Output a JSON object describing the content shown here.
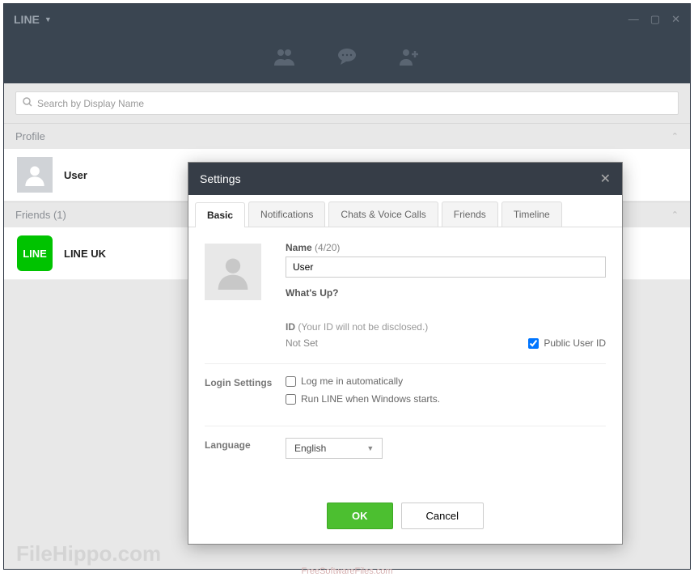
{
  "titlebar": {
    "app": "LINE"
  },
  "search": {
    "placeholder": "Search by Display Name"
  },
  "sections": {
    "profile": {
      "label": "Profile",
      "user_name": "User"
    },
    "friends": {
      "label": "Friends (1)",
      "item_name": "LINE UK",
      "logo_text": "LINE"
    }
  },
  "modal": {
    "title": "Settings",
    "tabs": {
      "basic": "Basic",
      "notifications": "Notifications",
      "chats": "Chats & Voice Calls",
      "friends": "Friends",
      "timeline": "Timeline"
    },
    "name_label": "Name",
    "name_hint": "(4/20)",
    "name_value": "User",
    "whatsup": "What's Up?",
    "id_label": "ID",
    "id_disclose": "(Your ID will not be disclosed.)",
    "id_value": "Not Set",
    "public_id_label": "Public User ID",
    "login_label": "Login Settings",
    "login_auto": "Log me in automatically",
    "login_startup": "Run LINE when Windows starts.",
    "language_label": "Language",
    "language_value": "English",
    "ok": "OK",
    "cancel": "Cancel"
  },
  "watermark": "FileHippo.com",
  "watermark2": "FreeSoftwareFiles.com"
}
